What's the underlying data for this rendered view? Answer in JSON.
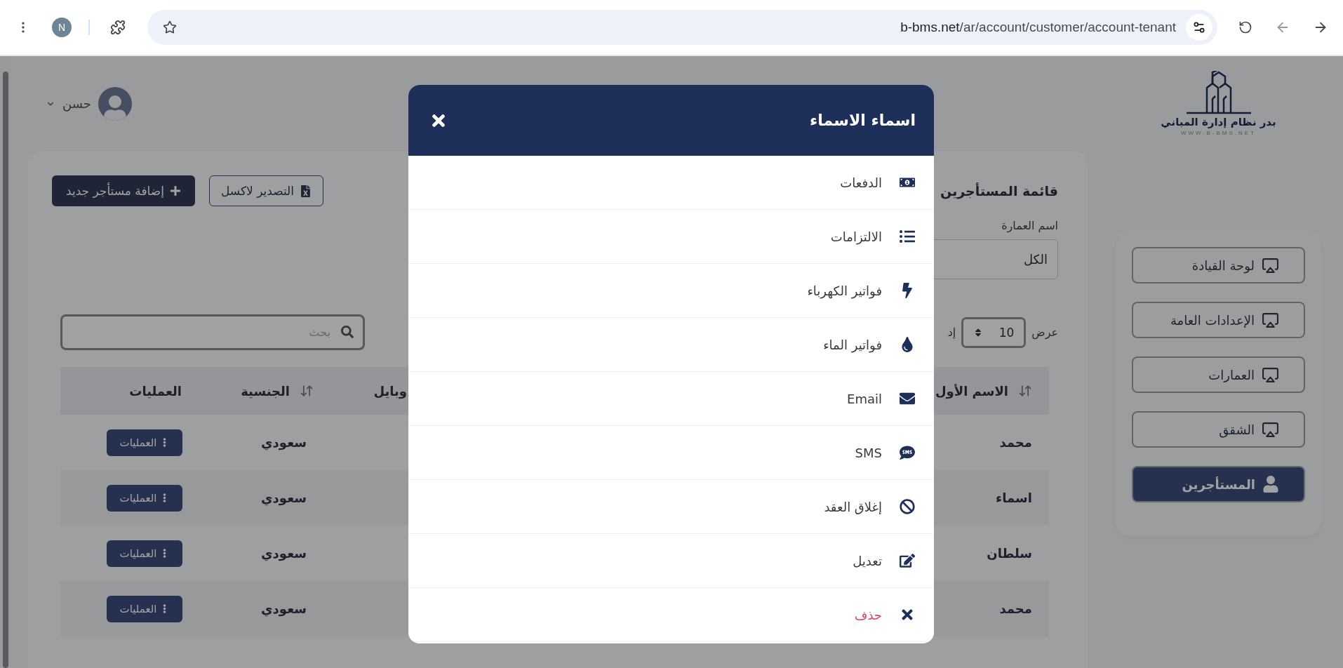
{
  "browser": {
    "avatar_letter": "N",
    "url_host": "b-bms.net",
    "url_path": "/ar/account/customer/account-tenant"
  },
  "logo": {
    "name": "بدر نظام إدارة المباني",
    "site": "WWW.B-BMS.NET"
  },
  "sidebar": {
    "items": [
      {
        "label": "لوحة القيادة",
        "selected": false
      },
      {
        "label": "الإعدادات العامة",
        "selected": false
      },
      {
        "label": "العمارات",
        "selected": false
      },
      {
        "label": "الشقق",
        "selected": false
      },
      {
        "label": "المستأجرين",
        "selected": true
      }
    ]
  },
  "user": {
    "name": "حسن"
  },
  "card": {
    "title": "قائمة المستأجرين",
    "export_button": "التصدير لاكسل",
    "add_button": "إضافة مستأجر جديد"
  },
  "filter": {
    "label": "اسم العمارة",
    "value": "الكل"
  },
  "page_length": {
    "label": "عرض",
    "value": "10",
    "suffix": "إد"
  },
  "search": {
    "placeholder": "بحث"
  },
  "table": {
    "columns": [
      {
        "label": "الاسم الأول",
        "sortable": true
      },
      {
        "label": "وبايل",
        "sortable": false
      },
      {
        "label": "الجنسية",
        "sortable": true
      },
      {
        "label": "العمليات",
        "sortable": false
      }
    ],
    "rows": [
      {
        "first_name": "محمد",
        "nationality": "سعودي",
        "actions_button": "العمليات"
      },
      {
        "first_name": "اسماء",
        "nationality": "سعودي",
        "actions_button": "العمليات"
      },
      {
        "first_name": "سلطان",
        "nationality": "سعودي",
        "actions_button": "العمليات"
      },
      {
        "first_name": "محمد",
        "nationality": "سعودي",
        "actions_button": "العمليات"
      }
    ]
  },
  "modal": {
    "title": "اسماء الاسماء",
    "items": [
      {
        "label": "الدفعات",
        "kind": "normal"
      },
      {
        "label": "الالتزامات",
        "kind": "normal"
      },
      {
        "label": "فواتير الكهرباء",
        "kind": "normal"
      },
      {
        "label": "فواتير الماء",
        "kind": "normal"
      },
      {
        "label": "Email",
        "kind": "normal"
      },
      {
        "label": "SMS",
        "kind": "normal"
      },
      {
        "label": "إغلاق العقد",
        "kind": "normal"
      },
      {
        "label": "تعديل",
        "kind": "normal"
      },
      {
        "label": "حذف",
        "kind": "danger"
      }
    ]
  }
}
